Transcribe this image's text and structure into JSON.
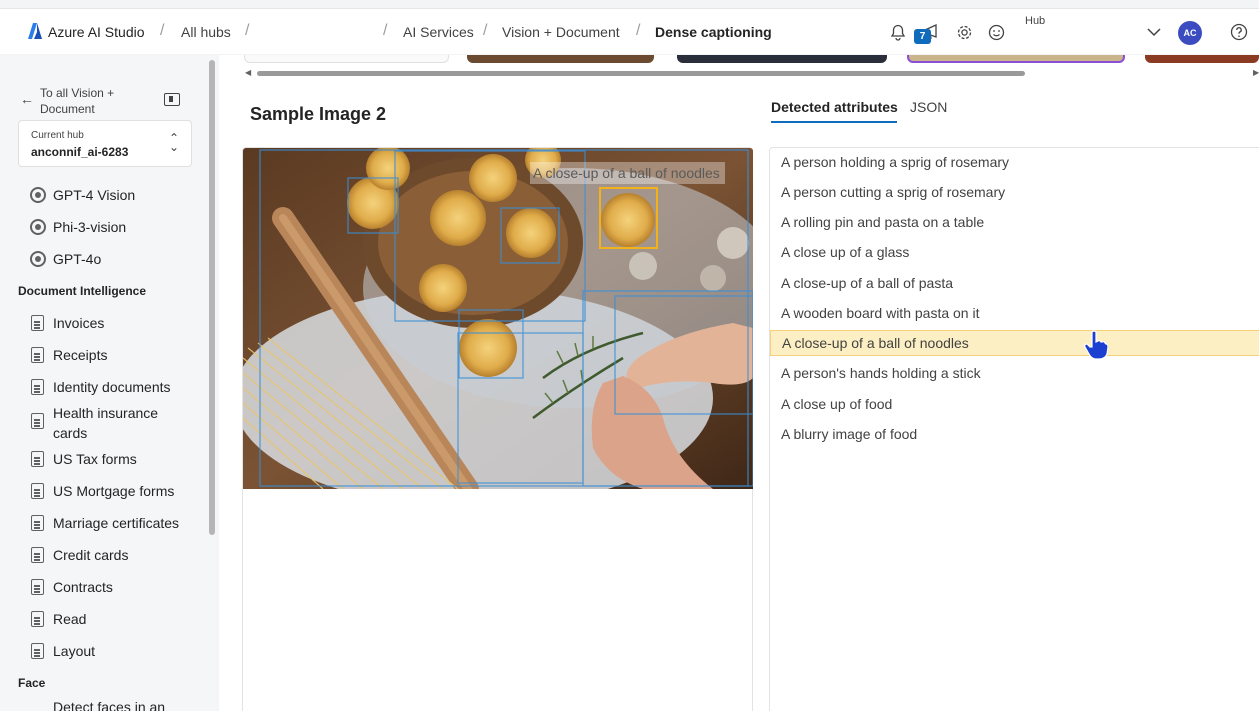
{
  "header": {
    "app_title": "Azure AI Studio",
    "breadcrumbs": [
      "All hubs",
      "AI Services",
      "Vision + Document",
      "Dense captioning"
    ],
    "notification_count": "7",
    "hub_label": "Hub",
    "avatar_initials": "AC"
  },
  "sidebar": {
    "back_label": "To all Vision + Document",
    "hub_card": {
      "label": "Current hub",
      "value": "anconnif_ai-6283"
    },
    "vision_items": [
      "GPT-4 Vision",
      "Phi-3-vision",
      "GPT-4o"
    ],
    "document_section": "Document Intelligence",
    "document_items": [
      "Invoices",
      "Receipts",
      "Identity documents",
      "Health insurance cards",
      "US Tax forms",
      "US Mortgage forms",
      "Marriage certificates",
      "Credit cards",
      "Contracts",
      "Read",
      "Layout"
    ],
    "face_section": "Face",
    "face_items": [
      "Detect faces in an"
    ]
  },
  "main": {
    "sample_title": "Sample Image 2",
    "tabs": [
      {
        "label": "Detected attributes",
        "active": true
      },
      {
        "label": "JSON",
        "active": false
      }
    ],
    "image_caption": "A close-up of a ball of noodles",
    "attributes": [
      "A person holding a sprig of rosemary",
      "A person cutting a sprig of rosemary",
      "A rolling pin and pasta on a table",
      "A close up of a glass",
      "A close-up of a ball of pasta",
      "A wooden board with pasta on it",
      "A close-up of a ball of noodles",
      "A person's hands holding a stick",
      "A close up of food",
      "A blurry image of food"
    ],
    "selected_attribute_index": 6
  },
  "colors": {
    "accent": "#0f6cbd",
    "selected_row": "#fcefc3",
    "highlight_box": "#f2b21a",
    "detection_box": "#3a8fd8"
  }
}
